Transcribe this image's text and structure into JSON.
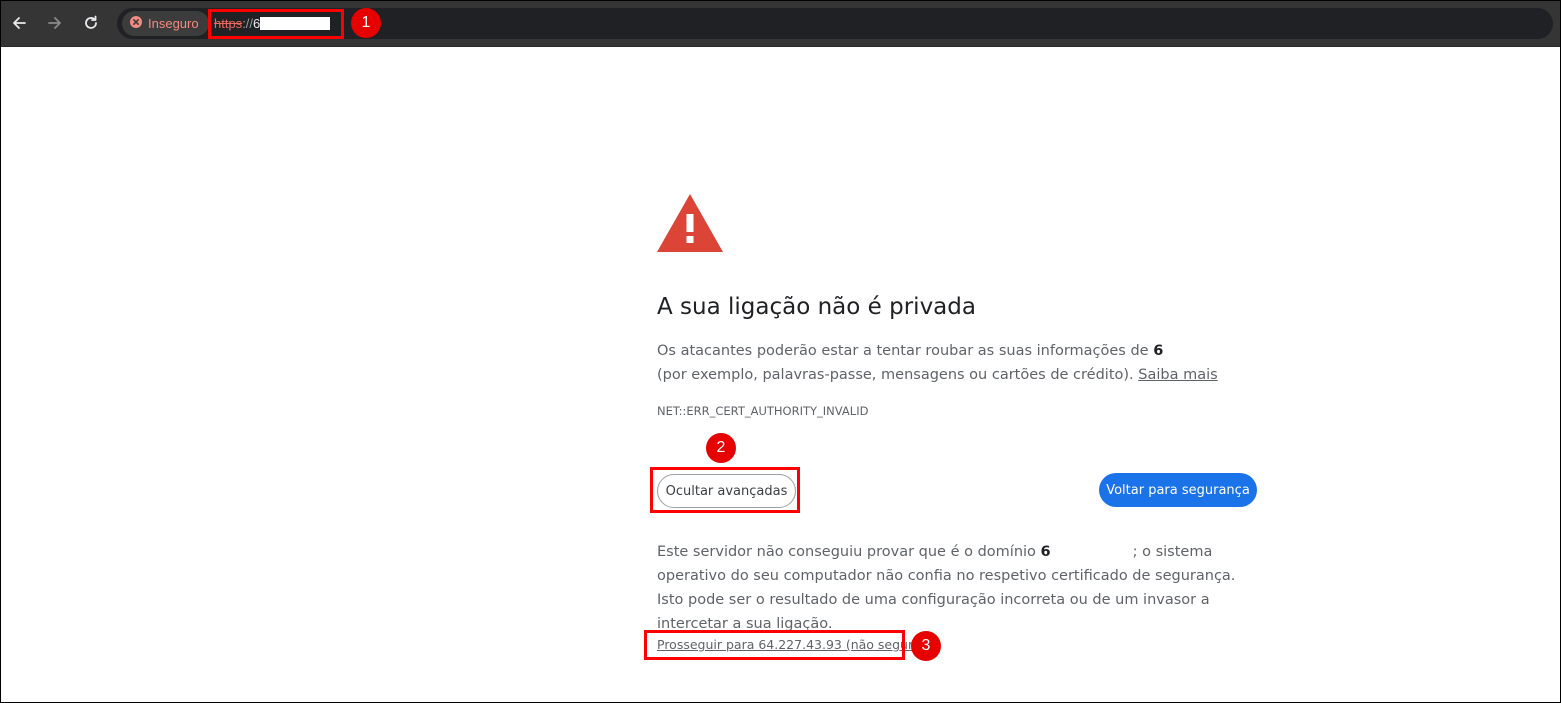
{
  "browser": {
    "back_icon": "arrow-left-icon",
    "forward_icon": "arrow-right-icon",
    "reload_icon": "reload-icon",
    "security_chip": {
      "icon": "error-circle-icon",
      "label": "Inseguro",
      "color": "#f28b82"
    },
    "url": {
      "protocol": "https",
      "separator": "://",
      "host_visible": "6"
    }
  },
  "interstitial": {
    "warning_icon": "warning-triangle-icon",
    "warning_color": "#db4437",
    "title": "A sua ligação não é privada",
    "intro_before": "Os atacantes poderão estar a tentar roubar as suas informações de ",
    "intro_host": "6",
    "intro_after": "(por exemplo, palavras-passe, mensagens ou cartões de crédito). ",
    "learn_more": "Saiba mais",
    "error_code": "NET::ERR_CERT_AUTHORITY_INVALID",
    "advanced_button": "Ocultar avançadas",
    "back_button": "Voltar para segurança",
    "back_button_color": "#1a73e8",
    "details_before": "Este servidor não conseguiu provar que é o domínio ",
    "details_host": "6",
    "details_after": "; o sistema operativo do seu computador não confia no respetivo certificado de segurança. Isto pode ser o resultado de uma configuração incorreta ou de um invasor a intercetar a sua ligação.",
    "proceed_link": "Prosseguir para 64.227.43.93 (não seguro)"
  },
  "annotations": {
    "color": "#ff0000",
    "labels": [
      "1",
      "2",
      "3"
    ]
  }
}
